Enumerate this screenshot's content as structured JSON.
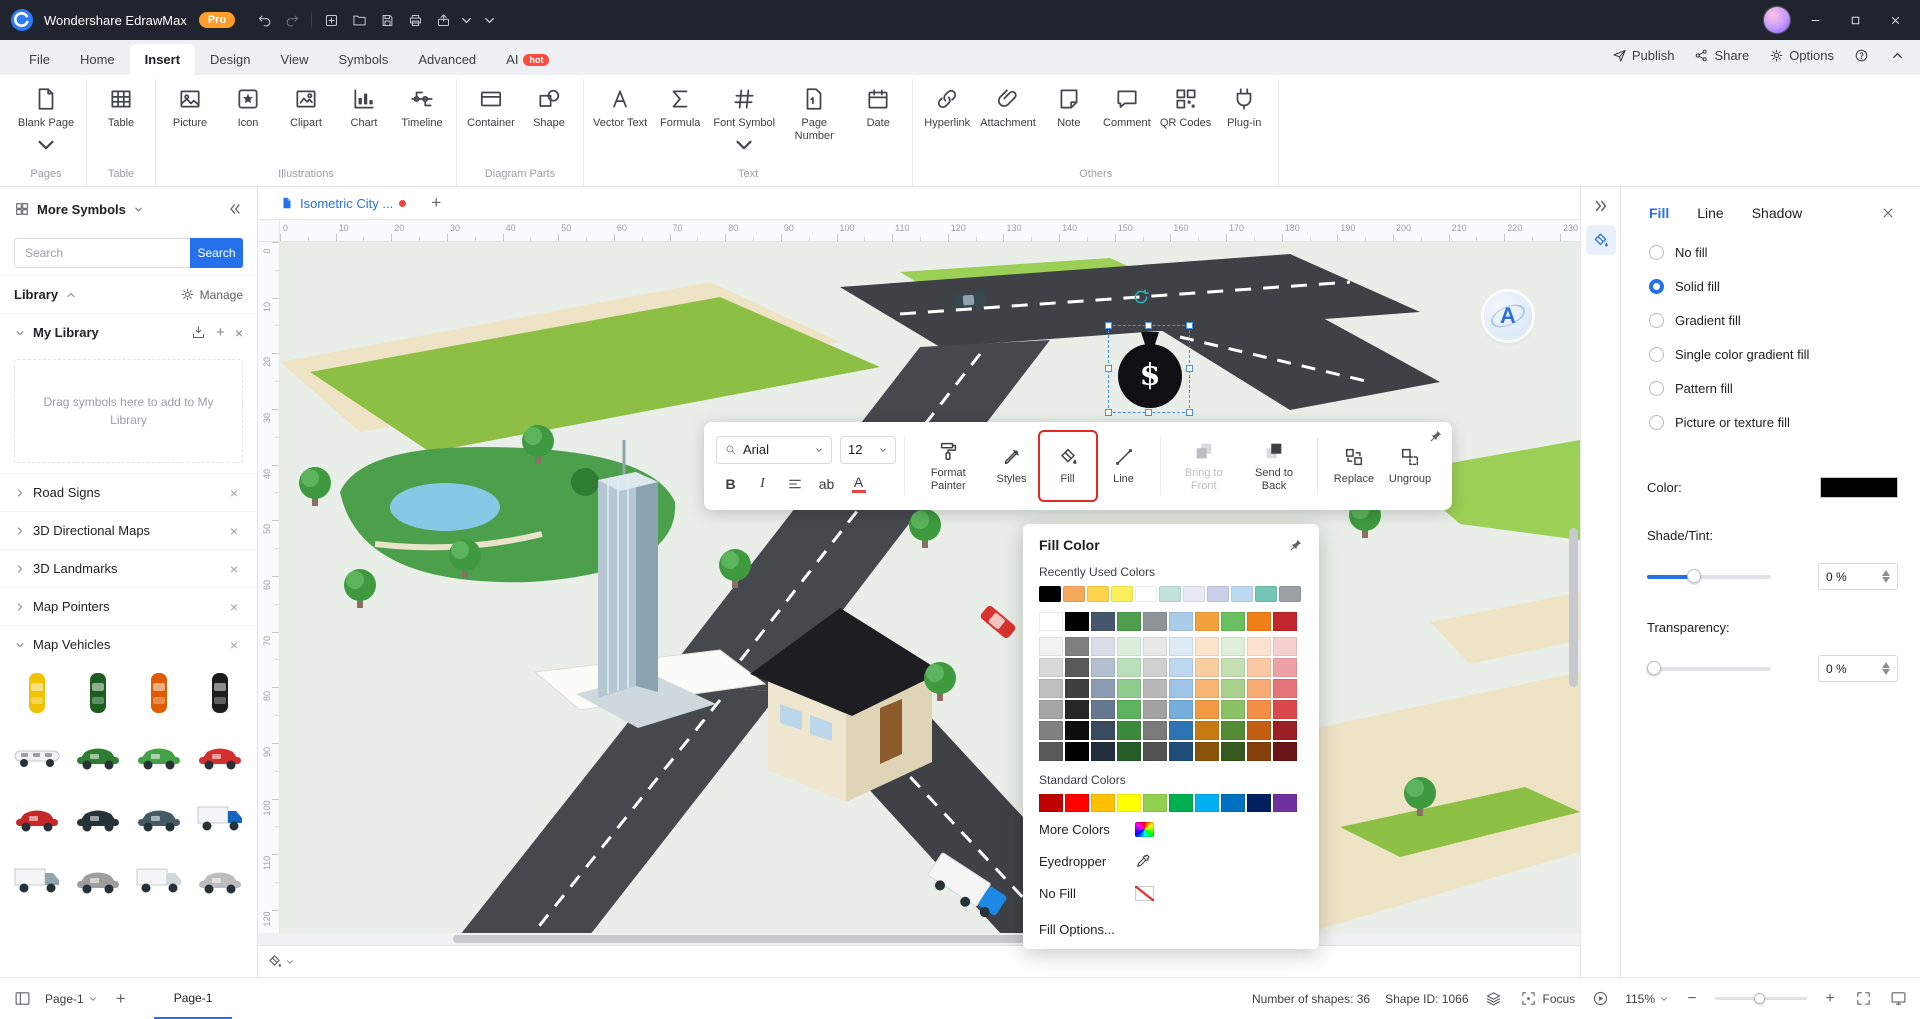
{
  "accent": "#2570eb",
  "titlebar": {
    "app_name": "Wondershare EdrawMax",
    "pro_badge": "Pro",
    "icons": [
      "undo",
      "redo",
      "new",
      "open",
      "save",
      "print",
      "export"
    ]
  },
  "menubar": {
    "tabs": [
      {
        "label": "File"
      },
      {
        "label": "Home"
      },
      {
        "label": "Insert",
        "active": true
      },
      {
        "label": "Design"
      },
      {
        "label": "View"
      },
      {
        "label": "Symbols"
      },
      {
        "label": "Advanced"
      },
      {
        "label": "AI",
        "badge": "hot"
      }
    ],
    "publish_label": "Publish",
    "share_label": "Share",
    "options_label": "Options"
  },
  "ribbon": {
    "groups": [
      {
        "label": "Pages",
        "items": [
          {
            "label": "Blank Page",
            "icon": "blank-page",
            "dropdown": true
          }
        ]
      },
      {
        "label": "Table",
        "items": [
          {
            "label": "Table",
            "icon": "table"
          }
        ]
      },
      {
        "label": "Illustrations",
        "items": [
          {
            "label": "Picture",
            "icon": "picture"
          },
          {
            "label": "Icon",
            "icon": "icon-symbol"
          },
          {
            "label": "Clipart",
            "icon": "clipart"
          },
          {
            "label": "Chart",
            "icon": "chart"
          },
          {
            "label": "Timeline",
            "icon": "timeline"
          }
        ]
      },
      {
        "label": "Diagram Parts",
        "items": [
          {
            "label": "Container",
            "icon": "container"
          },
          {
            "label": "Shape",
            "icon": "shape"
          }
        ]
      },
      {
        "label": "Text",
        "items": [
          {
            "label": "Vector Text",
            "icon": "vector-text"
          },
          {
            "label": "Formula",
            "icon": "formula"
          },
          {
            "label": "Font Symbol",
            "icon": "font-symbol",
            "dropdown": true
          },
          {
            "label": "Page Number",
            "icon": "page-number"
          },
          {
            "label": "Date",
            "icon": "date"
          }
        ]
      },
      {
        "label": "Others",
        "items": [
          {
            "label": "Hyperlink",
            "icon": "hyperlink"
          },
          {
            "label": "Attachment",
            "icon": "attachment"
          },
          {
            "label": "Note",
            "icon": "note"
          },
          {
            "label": "Comment",
            "icon": "comment"
          },
          {
            "label": "QR Codes",
            "icon": "qr-codes"
          },
          {
            "label": "Plug-in",
            "icon": "plug-in"
          }
        ]
      }
    ]
  },
  "sidebar": {
    "title": "More Symbols",
    "search_placeholder": "Search",
    "search_button": "Search",
    "library_label": "Library",
    "manage_label": "Manage",
    "my_library_label": "My Library",
    "drag_hint": "Drag symbols here to add to My Library",
    "libraries": [
      {
        "name": "Road Signs"
      },
      {
        "name": "3D Directional Maps"
      },
      {
        "name": "3D Landmarks"
      },
      {
        "name": "Map Pointers"
      },
      {
        "name": "Map Vehicles",
        "expanded": true
      }
    ],
    "vehicles": [
      {
        "style": "top",
        "color": "#f2c200"
      },
      {
        "style": "top",
        "color": "#1b5e20"
      },
      {
        "style": "top",
        "color": "#e05a00"
      },
      {
        "style": "top",
        "color": "#1c1c1c"
      },
      {
        "style": "limo",
        "color": "#f2f2f2"
      },
      {
        "style": "side",
        "color": "#2e7d32"
      },
      {
        "style": "side",
        "color": "#43a047"
      },
      {
        "style": "side",
        "color": "#d32f2f"
      },
      {
        "style": "side",
        "color": "#c62828"
      },
      {
        "style": "side",
        "color": "#263238"
      },
      {
        "style": "side",
        "color": "#455a64"
      },
      {
        "style": "truck",
        "color": "#1565c0"
      },
      {
        "style": "truck",
        "color": "#90a4ae"
      },
      {
        "style": "side",
        "color": "#9e9e9e"
      },
      {
        "style": "truck",
        "color": "#cfd8dc"
      },
      {
        "style": "side",
        "color": "#bdbdbd"
      }
    ]
  },
  "canvas": {
    "doc_tab_label": "Isometric City ...",
    "money_symbol": "$",
    "ai_badge": "A",
    "ruler_h": {
      "start": 0,
      "end": 230,
      "step": 10
    },
    "ruler_v": {
      "start": 0,
      "end": 120,
      "step": 10
    }
  },
  "float_toolbar": {
    "font_family": "Arial",
    "font_size": "12",
    "bold_label": "B",
    "italic_label": "I",
    "ab_label": "ab",
    "color_label": "A",
    "buttons": [
      {
        "label": "Format Painter",
        "icon": "format-painter"
      },
      {
        "label": "Styles",
        "icon": "styles"
      },
      {
        "label": "Fill",
        "icon": "fill-tool",
        "highlighted": true
      },
      {
        "label": "Line",
        "icon": "line-tool"
      },
      {
        "label": "Bring to Front",
        "icon": "bring-front",
        "disabled": true,
        "sep_before": true
      },
      {
        "label": "Send to Back",
        "icon": "send-back"
      },
      {
        "label": "Replace",
        "icon": "replace",
        "sep_before": true
      },
      {
        "label": "Ungroup",
        "icon": "ungroup"
      }
    ]
  },
  "fill_popup": {
    "title": "Fill Color",
    "recent_label": "Recently Used Colors",
    "recent_colors": [
      "#000000",
      "#f4a95c",
      "#ffd34d",
      "#fdee5a",
      "#ffffff",
      "#bfe3dc",
      "#e9e9f5",
      "#c9cfe8",
      "#bcd9f2",
      "#74c4b8",
      "#9aa0a6"
    ],
    "grid": [
      [
        "#ffffff",
        "#000000",
        "#46576d",
        "#4e9e4e",
        "#8f9498",
        "#a9cce8",
        "#f2a13c",
        "#6abf5e",
        "#f07f1a",
        "#c1272d"
      ],
      [
        "#f2f2f2",
        "#7f7f7f",
        "#d9dee6",
        "#dcefdc",
        "#e8e8e8",
        "#ddebf7",
        "#fce4cc",
        "#e0efd8",
        "#fde3cf",
        "#f6cfd0"
      ],
      [
        "#d9d9d9",
        "#595959",
        "#b3bfce",
        "#bae0ba",
        "#d0d0d0",
        "#bdd7ee",
        "#f8cda0",
        "#c4e0b2",
        "#fac8a2",
        "#eda3a5"
      ],
      [
        "#bfbfbf",
        "#404040",
        "#8c9cb3",
        "#8ecc8e",
        "#b9b9b9",
        "#9dc3e6",
        "#f5b470",
        "#a8d18c",
        "#f7ab72",
        "#e47578"
      ],
      [
        "#a6a6a6",
        "#262626",
        "#65788f",
        "#5eb35e",
        "#a1a1a1",
        "#76aedb",
        "#f09b43",
        "#8bc266",
        "#f48d45",
        "#db484c"
      ],
      [
        "#808080",
        "#0d0d0d",
        "#3a4a5e",
        "#3b8a3b",
        "#7a7a7a",
        "#2e74b5",
        "#c87a12",
        "#538c35",
        "#c25f12",
        "#9c1f24"
      ],
      [
        "#595959",
        "#000000",
        "#242f3d",
        "#265c26",
        "#525252",
        "#1f4e79",
        "#8a5408",
        "#37591f",
        "#843f0c",
        "#6a1518"
      ]
    ],
    "standard_label": "Standard Colors",
    "standard_colors": [
      "#c00000",
      "#ff0000",
      "#ffc000",
      "#ffff00",
      "#92d050",
      "#00b050",
      "#00b0f0",
      "#0070c0",
      "#002060",
      "#7030a0"
    ],
    "more_colors_label": "More Colors",
    "eyedropper_label": "Eyedropper",
    "no_fill_label": "No Fill",
    "fill_options_label": "Fill Options..."
  },
  "right_panel": {
    "tabs": [
      {
        "label": "Fill",
        "active": true
      },
      {
        "label": "Line"
      },
      {
        "label": "Shadow"
      }
    ],
    "fill_types": [
      {
        "label": "No fill"
      },
      {
        "label": "Solid fill",
        "selected": true
      },
      {
        "label": "Gradient fill"
      },
      {
        "label": "Single color gradient fill"
      },
      {
        "label": "Pattern fill"
      },
      {
        "label": "Picture or texture fill"
      }
    ],
    "color_label": "Color:",
    "color_value": "#000000",
    "shade_label": "Shade/Tint:",
    "shade_value": "0 %",
    "transparency_label": "Transparency:",
    "transparency_value": "0 %"
  },
  "palette_bar": {
    "colors": [
      "#e53935",
      "#f44336",
      "#ef5350",
      "#fb8c00",
      "#ffa726",
      "#ffc107",
      "#fdd835",
      "#ffee58",
      "#fff176",
      "#c0ca33",
      "#9ccc65",
      "#66bb6a",
      "#4caf50",
      "#2e7d32",
      "#26a69a",
      "#00897b",
      "#26c6da",
      "#00acc1",
      "#29b6f6",
      "#039be5",
      "#1e88e5",
      "#1565c0",
      "#0d47a1",
      "#5c6bc0",
      "#3949ab",
      "#7e57c2",
      "#5e35b1",
      "#ab47bc",
      "#8e24aa",
      "#ec407a",
      "#d81b60",
      "#f06292",
      "#f8bbd0",
      "#e1bee7",
      "#d1c4e9",
      "#c5cae9",
      "#bbdefb",
      "#b3e5fc",
      "#b2dfdb",
      "#c8e6c9",
      "#dcedc8",
      "#fff9c4",
      "#ffe0b2",
      "#000000",
      "#212121",
      "#424242",
      "#616161",
      "#757575",
      "#9e9e9e",
      "#bdbdbd",
      "#e0e0e0",
      "#ffffff"
    ]
  },
  "statusbar": {
    "page_selector_label": "Page-1",
    "active_page_label": "Page-1",
    "shapes_count_label": "Number of shapes: 36",
    "shape_id_label": "Shape ID: 1066",
    "focus_label": "Focus",
    "zoom_value": "115%"
  }
}
